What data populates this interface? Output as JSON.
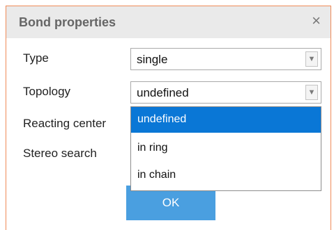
{
  "dialog": {
    "title": "Bond properties",
    "close_icon": "×"
  },
  "fields": {
    "type": {
      "label": "Type",
      "value": "single"
    },
    "topology": {
      "label": "Topology",
      "value": "undefined"
    },
    "reacting_center": {
      "label": "Reacting center"
    },
    "stereo_search": {
      "label": "Stereo search"
    }
  },
  "topology_dropdown": {
    "options": [
      "undefined",
      "in ring",
      "in chain"
    ],
    "selected_index": 0
  },
  "ok_label": "OK",
  "colors": {
    "border_accent": "#ef8a57",
    "selected_option": "#0a77d6",
    "ok_button": "#4a9fe0",
    "titlebar": "#eaeaea"
  },
  "icons": {
    "close": "close-icon",
    "caret": "chevron-down-icon"
  }
}
